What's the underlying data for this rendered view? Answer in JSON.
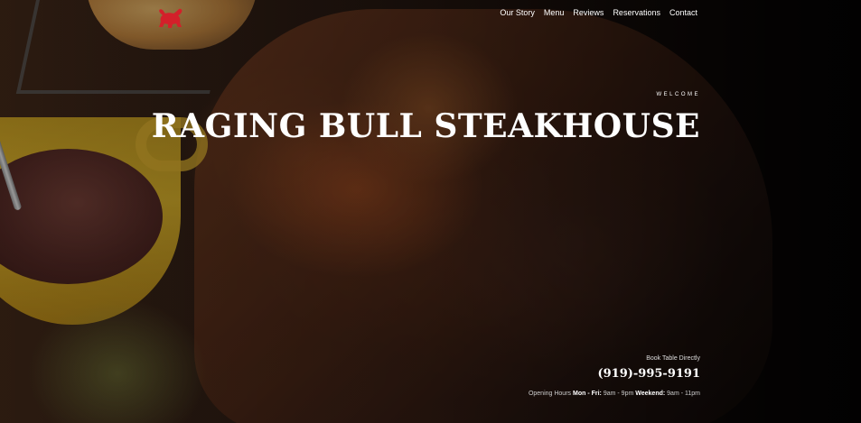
{
  "colors": {
    "accent_red": "#d3202a",
    "text_white": "#ffffff",
    "background_dark": "#1a0f0a"
  },
  "logo": {
    "icon": "bull-logo-icon"
  },
  "nav": {
    "items": [
      {
        "label": "Our Story"
      },
      {
        "label": "Menu"
      },
      {
        "label": "Reviews"
      },
      {
        "label": "Reservations"
      },
      {
        "label": "Contact"
      }
    ]
  },
  "hero": {
    "eyebrow": "WELCOME",
    "title": "RAGING BULL STEAKHOUSE",
    "booking_label": "Book Table Directly",
    "phone": "(919)-995-9191",
    "hours": {
      "label": "Opening Hours",
      "weekday_label": "Mon - Fri:",
      "weekday_hours": "9am - 9pm",
      "weekend_label": "Weekend:",
      "weekend_hours": "9am - 11pm"
    }
  }
}
